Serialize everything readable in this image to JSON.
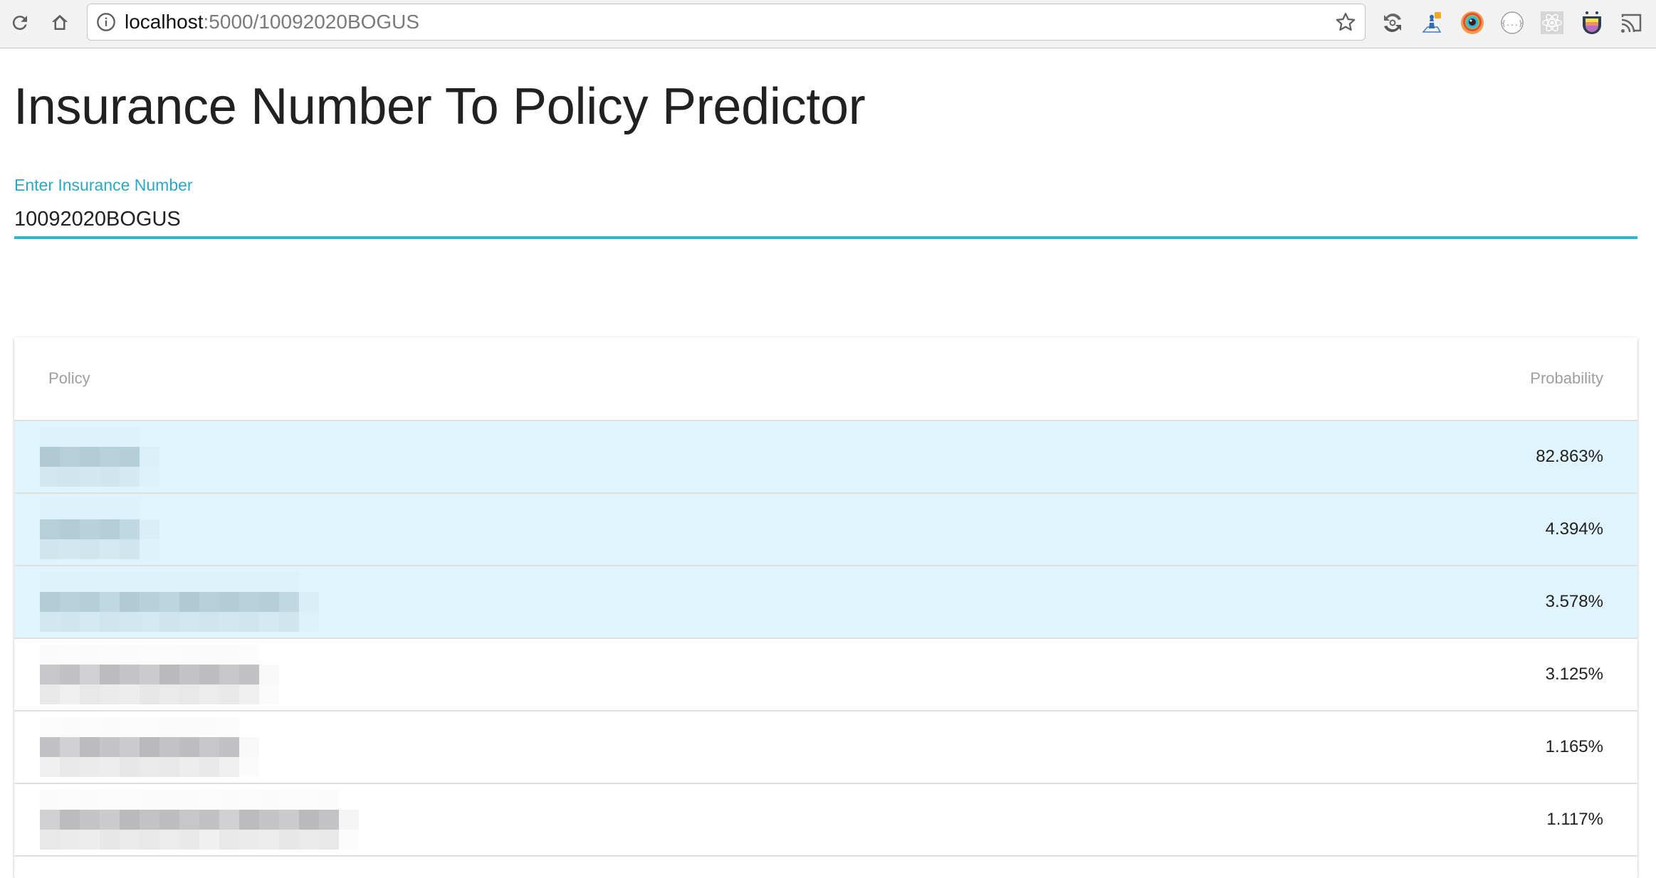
{
  "browser": {
    "url_host": "localhost",
    "url_rest": ":5000/10092020BOGUS",
    "nav_icons": [
      "reload-icon",
      "home-icon"
    ],
    "url_icons": [
      "info-icon",
      "bookmark-star-icon"
    ],
    "extensions": [
      "sync-extension-icon",
      "chess-extension-icon",
      "color-eye-extension-icon",
      "json-viewer-extension-icon",
      "react-devtools-icon",
      "tongue-cup-extension-icon",
      "cast-icon"
    ]
  },
  "page": {
    "title": "Insurance Number To Policy Predictor",
    "input": {
      "label": "Enter Insurance Number",
      "value": "10092020BOGUS"
    },
    "colors": {
      "accent": "#31b5cf",
      "selected_row": "#e0f4fd",
      "header_text": "#9e9e9e",
      "divider": "#e0e0e0"
    }
  },
  "table": {
    "columns": [
      "Policy",
      "Probability"
    ],
    "rows": [
      {
        "policy": "[redacted]",
        "probability": "82.863%",
        "selected": true
      },
      {
        "policy": "[redacted]",
        "probability": "4.394%",
        "selected": true
      },
      {
        "policy": "[redacted]",
        "probability": "3.578%",
        "selected": true
      },
      {
        "policy": "[redacted]",
        "probability": "3.125%",
        "selected": false
      },
      {
        "policy": "[redacted]",
        "probability": "1.165%",
        "selected": false
      },
      {
        "policy": "[redacted]",
        "probability": "1.117%",
        "selected": false
      }
    ]
  }
}
